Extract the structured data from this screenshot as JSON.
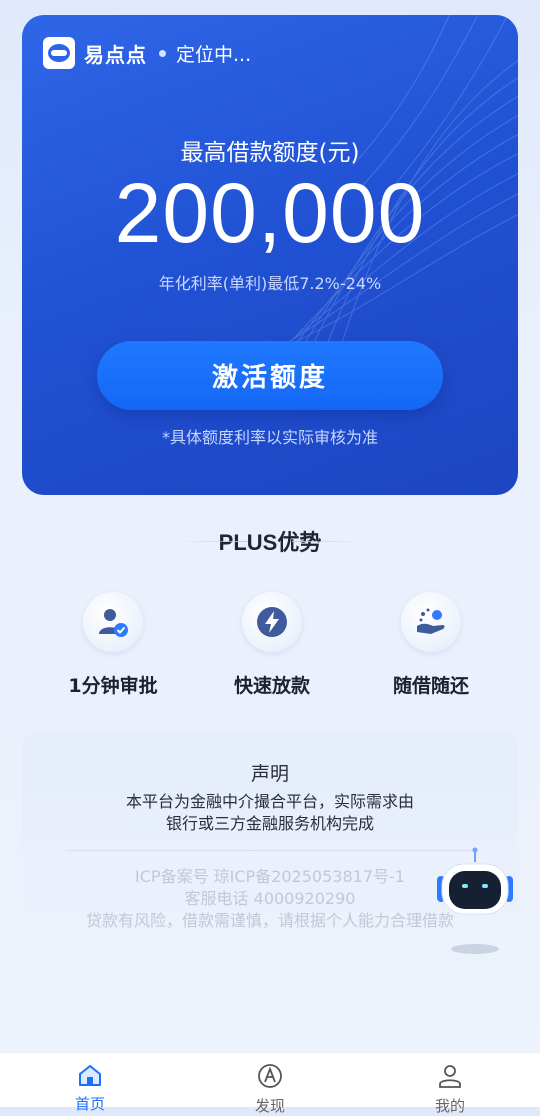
{
  "header": {
    "app_name": "易点点",
    "location": "定位中..."
  },
  "hero": {
    "limit_label": "最高借款额度(元)",
    "amount": "200,000",
    "rate_text": "年化利率(单利)最低7.2%-24%",
    "activate_label": "激活额度",
    "note": "*具体额度利率以实际审核为准"
  },
  "plus": {
    "title": "PLUS优势",
    "features": [
      {
        "label": "1分钟审批",
        "icon": "user-check-icon"
      },
      {
        "label": "快速放款",
        "icon": "lightning-icon"
      },
      {
        "label": "随借随还",
        "icon": "hand-coin-icon"
      }
    ]
  },
  "declaration": {
    "title": "声明",
    "body_line1": "本平台为金融中介撮合平台，实际需求由",
    "body_line2": "银行或三方金融服务机构完成",
    "icp": "ICP备案号 琼ICP备2025053817号-1",
    "phone": "客服电话 4000920290",
    "risk": "贷款有风险，借款需谨慎，请根据个人能力合理借款"
  },
  "tabbar": {
    "tabs": [
      {
        "label": "首页",
        "icon": "home-icon",
        "active": true
      },
      {
        "label": "发现",
        "icon": "compass-icon",
        "active": false
      },
      {
        "label": "我的",
        "icon": "profile-icon",
        "active": false
      }
    ]
  },
  "colors": {
    "hero_blue": "#2456d8",
    "button_blue": "#1a70fb",
    "active_tab": "#1a70fb"
  }
}
